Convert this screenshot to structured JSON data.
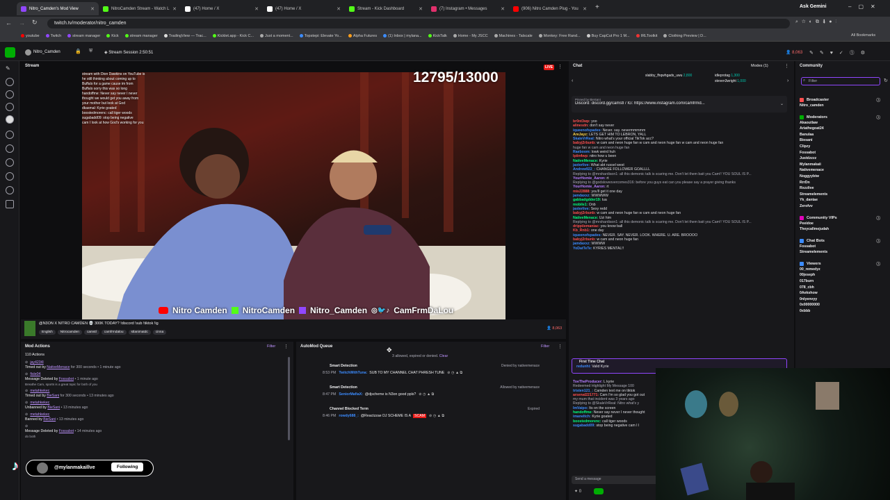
{
  "browser": {
    "tabs": [
      {
        "title": "Nitro_Camden's Mod View",
        "active": true,
        "color": "#9147ff"
      },
      {
        "title": "NitroCamden Stream - Watch L",
        "color": "#53fc18"
      },
      {
        "title": "(47) Home / X",
        "color": "#ffffff"
      },
      {
        "title": "(47) Home / X",
        "color": "#ffffff"
      },
      {
        "title": "Stream - Kick Dashboard",
        "color": "#53fc18"
      },
      {
        "title": "(7) Instagram • Messages",
        "color": "#e1306c"
      },
      {
        "title": "(906) Nitro Camden Plug - You",
        "color": "#ff0000"
      }
    ],
    "ask_gemini": "Ask Gemini",
    "url": "twitch.tv/moderator/nitro_camden",
    "bookmarks": [
      "youtube",
      "Twitch",
      "stream manager",
      "Kick",
      "stream manager",
      "TradingView — Trac...",
      "Kicklet.app - Kick C...",
      "Just a moment...",
      "Topstepi: Elevate Yo...",
      "Alpha Futures",
      "(1) Inbox | mylana...",
      "KickTalk",
      "Home - My JSCC",
      "Machines - Talscale",
      "Monkey: Free Rand...",
      "Buy CapCut Pro 1 M...",
      "IRLToolkit",
      "Clothing Preview | D..."
    ],
    "all_bookmarks": "All Bookmarks"
  },
  "top": {
    "channel": "Nitro_Camden",
    "session": "Stream Session 2:50:51",
    "viewers": "8,063"
  },
  "stream": {
    "label": "Stream",
    "live": "LIVE",
    "counter": "12795/13000",
    "overlay_chat": [
      "stream with Dion Dawkins on YouTube is",
      "he still thinking about coming up to",
      "Buffalo for a game cause im from",
      "Buffalo sorry this was so long",
      "handoffme: Never say never I never",
      "thought we would get you away from",
      "your mother but look at God",
      "dkasmal: Kyrie goated",
      "boostedmorenc: call tiger woods",
      "sugabadd09: stop being negative",
      "cam I look at how God's working for you"
    ],
    "banner": [
      "Nitro Camden",
      "NitroCamden",
      "Nitro_Camden",
      "CamFrmDaLou"
    ],
    "title": "@N3ON X NITRO CAMDEN 💀 300K TODAY? !discord !sub !tiktok !ig",
    "tags": [
      "English",
      "Nitrocamden",
      "camstl",
      "camfrmdalou",
      "stlanimatdc",
      "cinna"
    ],
    "viewers": "8,063"
  },
  "mod_actions": {
    "title": "Mod Actions",
    "filter": "Filter",
    "count": "110 Actions",
    "items": [
      {
        "user": "jay4234l",
        "text": "Timed out by",
        "by": "NativeMenace",
        "tail": "for 300 seconds • 1 minute ago"
      },
      {
        "user": "fisle04",
        "text": "Message Deleted by",
        "by": "Fossabot",
        "tail": "• 1 minute ago",
        "note": "Breathe Cam, sports is a great topic for both of you"
      },
      {
        "user": "metahkekec",
        "text": "Timed out by",
        "by": "BieSani",
        "tail": "for 300 seconds • 13 minutes ago"
      },
      {
        "user": "metahkekec",
        "text": "Unbanned by",
        "by": "BieSani",
        "tail": "• 13 minutes ago"
      },
      {
        "user": "metahkekec",
        "text": "Banned by",
        "by": "BieSani",
        "tail": "• 13 minutes ago"
      },
      {
        "user": "",
        "text": "Message Deleted by",
        "by": "Fossabot",
        "tail": "• 14 minutes ago",
        "note": "do both"
      }
    ]
  },
  "automod": {
    "title": "AutoMod Queue",
    "filter": "Filter",
    "sub": "3 allowed, expired or denied.",
    "clear": "Clear",
    "items": [
      {
        "kind": "Smart Detection",
        "status": "Denied by nativemenace",
        "time": "8:53 PM",
        "user": "TwitchWithTuna:",
        "msg": "SUB TO MY CHANNEL CHAT PHRESH TUNE"
      },
      {
        "kind": "Smart Detection",
        "status": "Allowed by nativemenace",
        "time": "8:47 PM",
        "user": "SeniorMafiaX:",
        "msg": "@djscheme is N3on good ppls?"
      },
      {
        "kind": "Channel Blocked Term",
        "status": "Expired",
        "time": "8:46 PM",
        "user": "rowdy688_:",
        "msg": "@Reactzzae DJ SCHEME IS A",
        "flag": "SCAM"
      }
    ]
  },
  "chat": {
    "title": "Chat",
    "modes": "Modes (1)",
    "gifters": [
      {
        "name": "slabby_fhqwhgads_uwu",
        "amt": "2,800"
      },
      {
        "name": "idleprotag",
        "amt": "1,300"
      },
      {
        "name": "steven3wright",
        "amt": "1,000"
      }
    ],
    "pinned_by": "Pinned by BieSani",
    "pinned": "Discord: discord.gg/camstl / IG: https://www.instagram.com/camfrmd...",
    "messages": [
      {
        "u": "br0nt3wp:",
        "c": "#ff4f4f",
        "t": "yoo"
      },
      {
        "u": "alinesdn:",
        "c": "#ff4f4f",
        "t": "don't say never"
      },
      {
        "u": "iqueenofspades:",
        "c": "#3c8cff",
        "t": "Never. say. nevermmmmm"
      },
      {
        "u": "AreJayz:",
        "c": "#ffd84a",
        "t": "LETS GET HIM TO LEBRON, YALL"
      },
      {
        "u": "SkaleVrReal:",
        "c": "#3c8cff",
        "t": "Nitro what's your official TikTok acc?"
      },
      {
        "u": "babyj2rbunb:",
        "c": "#ff4f4f",
        "t": "w cam and neon huge fan w cam and neon huge fan w cam and neon huge fan"
      },
      {
        "u": "",
        "c": "#ff4f4f",
        "t": "huge fan w cam and neon huge fan"
      },
      {
        "u": "Raeboom:",
        "c": "#3c8cff",
        "t": "lowk weird huh"
      },
      {
        "u": "lpiin4wp:",
        "c": "#ff4f4f",
        "t": "nitro how u been"
      },
      {
        "u": "NativeMenace:",
        "c": "#00ff7f",
        "t": "Kyrie"
      },
      {
        "u": "jaxterlive:",
        "c": "#3c8cff",
        "t": "What abt russel west"
      },
      {
        "u": "Andrew922_:",
        "c": "#3c8cff",
        "t": "CHANGE FOLLOWER GOALLLL"
      },
      {
        "u": "",
        "c": "#aaa",
        "t": "Replying to @mrshardison1: all this demonic talk is scaring me. Don't let them bait you Cam!! YOU SOUL IS P..."
      },
      {
        "u": "YourHomie_Aaron:",
        "c": "#b57cff",
        "t": "rt"
      },
      {
        "u": "",
        "c": "#aaa",
        "t": "Replying to @godsloveovercomes316: before you guys eat can you please say a prayer giving thanks"
      },
      {
        "u": "YourHomie_Aaron:",
        "c": "#b57cff",
        "t": "rt"
      },
      {
        "u": "mis22888:",
        "c": "#ff4f4f",
        "t": "you'll get it one day"
      },
      {
        "u": "jamdaxxz:",
        "c": "#3c8cff",
        "t": "WWWWW"
      },
      {
        "u": "gabbadgdder19:",
        "c": "#00ff7f",
        "t": "lua"
      },
      {
        "u": "mobile1:",
        "c": "#00ff7f",
        "t": "Onb"
      },
      {
        "u": "jaxterlive:",
        "c": "#3c8cff",
        "t": "Sexy redd"
      },
      {
        "u": "babyj2rbunb:",
        "c": "#ff4f4f",
        "t": "w cam and neon huge fan w cam and neon huge fan"
      },
      {
        "u": "NativeMenace:",
        "c": "#00ff7f",
        "t": "Uzi him"
      },
      {
        "u": "",
        "c": "#aaa",
        "t": "Replying to @mrshardison1: all this demonic talk is scaring me. Don't let them bait you Cam!! YOU SOUL IS P..."
      },
      {
        "u": "drippiiemaniac:",
        "c": "#ff4f4f",
        "t": "you know ball"
      },
      {
        "u": "Kb_Rnb1:",
        "c": "#ff4f4f",
        "t": "one day"
      },
      {
        "u": "iqueenofspades:",
        "c": "#3c8cff",
        "t": "NEVER. SAY. NEVER. LOOK. WHERE. U. ARE. BROOOO"
      },
      {
        "u": "babyj2rbunb:",
        "c": "#ff4f4f",
        "t": "w cam and neon huge fan"
      },
      {
        "u": "jamdaxxz:",
        "c": "#3c8cff",
        "t": "WWWW"
      },
      {
        "u": "YoDatTeTe:",
        "c": "#3c8cff",
        "t": "KYRIES MENTAL!!"
      }
    ],
    "first_time": "First Time Chat",
    "first_msg": {
      "u": "redunhi:",
      "t": "Valid Kyrie"
    },
    "lower": [
      {
        "u": "ToeTheProducer:",
        "c": "#b57cff",
        "t": "L kyrie"
      },
      {
        "u": "",
        "c": "#aaa",
        "t": "Redeemed Highlight My Message  100"
      },
      {
        "u": "tristen121_:",
        "c": "#3c8cff",
        "t": "Camden text me on tiktok"
      },
      {
        "u": "arsenal221771:",
        "c": "#ff4f4f",
        "t": "Cam I'm so glad you got out"
      },
      {
        "u": "",
        "c": "#aaa",
        "t": "my mum that incident was 3 years ago"
      },
      {
        "u": "",
        "c": "#aaa",
        "t": "Replying to @SkaleVrReal: Nitro what's y"
      },
      {
        "u": "ImVaipo:",
        "c": "#3c8cff",
        "t": "Its on the screen"
      },
      {
        "u": "handoffme:",
        "c": "#00ff7f",
        "t": "Never say never I never thought"
      },
      {
        "u": "imaneltch:",
        "c": "#3c8cff",
        "t": "Kyrie goated"
      },
      {
        "u": "boostedmorenc:",
        "c": "#00ff7f",
        "t": "call tiger woods"
      },
      {
        "u": "sugabadd09:",
        "c": "#3c8cff",
        "t": "stop being negative cam I l"
      }
    ],
    "send_placeholder": "Send a message",
    "points": "0"
  },
  "community": {
    "title": "Community",
    "filter_placeholder": "Filter",
    "groups": [
      {
        "name": "Broadcaster",
        "color": "#ff4f4f",
        "users": [
          "Nitro_camden"
        ]
      },
      {
        "name": "Moderators",
        "color": "#00ad03",
        "users": [
          "Akaoutlaw",
          "Ariathegoat24",
          "Banulaa",
          "Biesani",
          "Clipzy",
          "Fossabot",
          "Justdzzzz",
          "Mylanmakaii",
          "Nativemenace",
          "Noggyybtw",
          "RrrDn",
          "Rxzzlive",
          "Streamelements",
          "Yk_dantae",
          "Zerofvv"
        ]
      },
      {
        "name": "Community VIPs",
        "color": "#e005b9",
        "users": [
          "Peeidoe",
          "Theycallmejudah"
        ]
      },
      {
        "name": "Chat Bots",
        "color": "#3c8cff",
        "users": [
          "Fossabot",
          "Streamelements"
        ]
      },
      {
        "name": "Viewers",
        "color": "#3c8cff",
        "users": [
          "00_remedyz",
          "00jeseph",
          "017burn",
          "078_cbh",
          "0Aekshow",
          "0nlyenvyy",
          "0x00000000",
          "0xbbb"
        ]
      }
    ]
  },
  "tiktok": {
    "handle": "@mylanmakaillve",
    "follow": "Following"
  }
}
